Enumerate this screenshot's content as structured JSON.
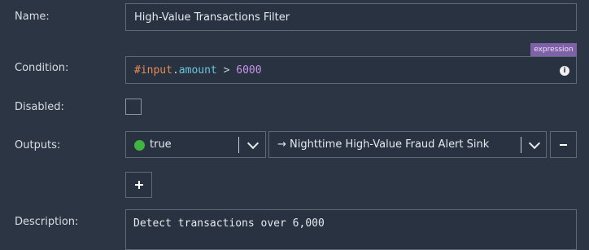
{
  "form": {
    "name": {
      "label": "Name:",
      "value": "High-Value Transactions Filter"
    },
    "condition": {
      "label": "Condition:",
      "badge": "expression",
      "tokens": {
        "var": "#input",
        "dot": ".",
        "prop": "amount",
        "op": " > ",
        "num": "6000"
      },
      "info_icon": "i"
    },
    "disabled": {
      "label": "Disabled:",
      "checked": false
    },
    "outputs": {
      "label": "Outputs:",
      "condition_value": "true",
      "target": "→ Nighttime High-Value Fraud Alert Sink",
      "remove_label": "-"
    },
    "add_output_label": "+",
    "description": {
      "label": "Description:",
      "value": "Detect transactions over 6,000"
    }
  },
  "colors": {
    "background": "#2b3543",
    "border": "#5d6878",
    "badge": "#7f61a7",
    "token_var": "#e98a52",
    "token_prop": "#6cc5dc",
    "token_num": "#c792ea",
    "status_green": "#3fb43f"
  },
  "icons": [
    "chevron-down-icon",
    "info-icon",
    "status-dot-icon",
    "plus-icon",
    "minus-icon"
  ]
}
